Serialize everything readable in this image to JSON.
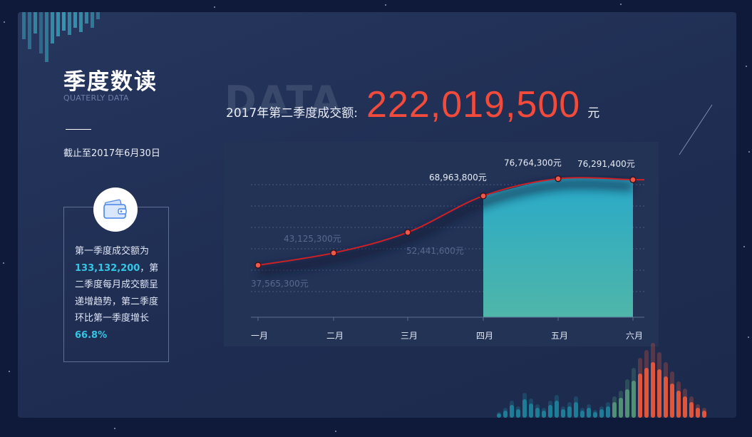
{
  "panel": {
    "title": "季度数读",
    "subtitle": "QUATERLY DATA",
    "cutoff_date": "截止至2017年6月30日"
  },
  "summary": {
    "text_1": "第一季度成交额为",
    "q1_total": "133,132,200",
    "text_2": "，第二季度每月成交额呈递增趋势，第二季度环比第一季度增长",
    "growth": "66.8%",
    "icon": "wallet-icon"
  },
  "headline": {
    "background_word": "DATA",
    "label": "2017年第二季度成交额:",
    "value": "222,019,500",
    "unit": "元"
  },
  "colors": {
    "accent": "#35c6e4",
    "highlight_red": "#f24a3b",
    "line_red": "#d11f26",
    "area_top": "#29a9c9",
    "area_bottom": "#4fb6a9"
  },
  "chart_data": {
    "type": "line",
    "categories": [
      "一月",
      "二月",
      "三月",
      "四月",
      "五月",
      "六月"
    ],
    "series": [
      {
        "values": [
          37565300,
          43125300,
          52441600,
          68963800,
          76764300,
          76291400
        ]
      }
    ],
    "data_labels": [
      "37,565,300元",
      "43,125,300元",
      "52,441,600元",
      "68,963,800元",
      "76,764,300元",
      "76,291,400元"
    ],
    "highlighted_range": [
      "四月",
      "六月"
    ],
    "ylim": [
      14000000,
      87000000
    ],
    "grid": true
  }
}
